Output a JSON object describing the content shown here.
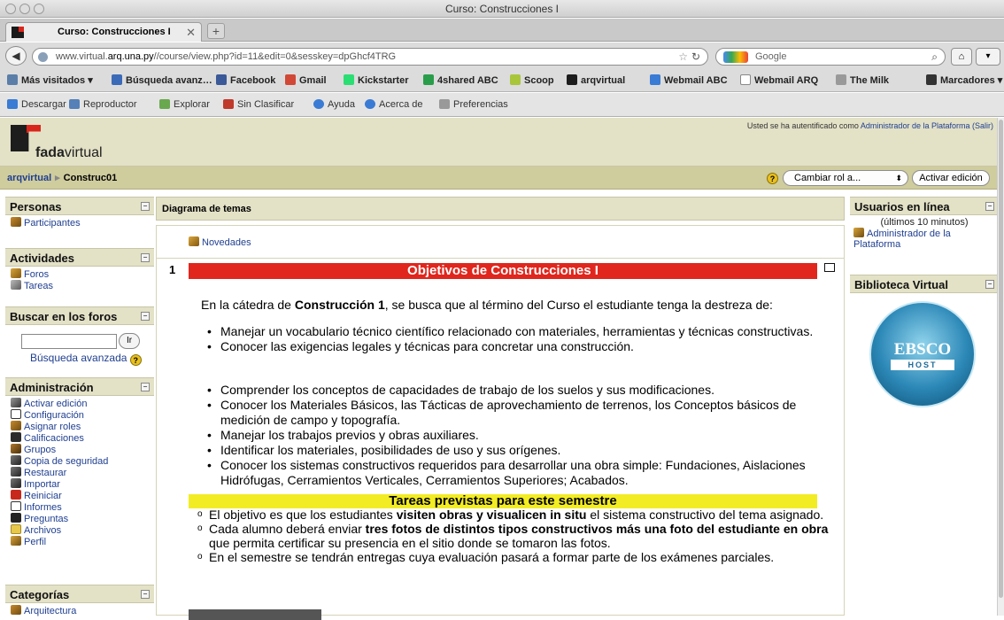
{
  "window": {
    "title": "Curso: Construcciones I"
  },
  "tab": {
    "label": "Curso: Construcciones I",
    "close": "✕",
    "new": "+"
  },
  "nav": {
    "url_prefix": "www.virtual.",
    "url_domain": "arq.una.py",
    "url_path": "//course/view.php?id=11&edit=0&sesskey=dpGhcf4TRG",
    "search_engine": "Google"
  },
  "bookmarks": [
    {
      "label": "Más visitados ▾",
      "icon": "most-visited-icon",
      "color": "#5a7ea8"
    },
    {
      "label": "Búsqueda avanz…",
      "icon": "search-advanced-icon",
      "color": "#3b6ab8"
    },
    {
      "label": "Facebook",
      "icon": "facebook-icon",
      "color": "#3b5998"
    },
    {
      "label": "Gmail",
      "icon": "gmail-icon",
      "color": "#d14836"
    },
    {
      "label": "Kickstarter",
      "icon": "kickstarter-icon",
      "color": "#2bde73"
    },
    {
      "label": "4shared ABC",
      "icon": "4shared-icon",
      "color": "#2a9d4a"
    },
    {
      "label": "Scoop",
      "icon": "scoop-icon",
      "color": "#a9c63a"
    },
    {
      "label": "arqvirtual",
      "icon": "arqvirtual-icon",
      "color": "#1d1d1d"
    },
    {
      "label": "Webmail ABC",
      "icon": "webmail-abc-icon",
      "color": "#3a7bd5"
    },
    {
      "label": "Webmail ARQ",
      "icon": "webmail-arq-icon",
      "color": "#ffffff"
    },
    {
      "label": "The Milk",
      "icon": "milk-icon",
      "color": "#999999"
    }
  ],
  "bookmarks_menu": "Marcadores ▾",
  "addons": [
    {
      "label": "Descargar",
      "icon": "download-icon",
      "color": "#3a7bd5"
    },
    {
      "label": "Reproductor",
      "icon": "player-icon",
      "color": "#5580b8"
    },
    {
      "label": "Explorar",
      "icon": "explore-icon",
      "color": "#6aa84f"
    },
    {
      "label": "Sin Clasificar",
      "icon": "unclassified-icon",
      "color": "#c0392b"
    },
    {
      "label": "Ayuda",
      "icon": "help-icon",
      "color": "#3a7bd5"
    },
    {
      "label": "Acerca de",
      "icon": "about-icon",
      "color": "#3a7bd5"
    },
    {
      "label": "Preferencias",
      "icon": "preferences-icon",
      "color": "#999999"
    }
  ],
  "site": {
    "logo_bold": "fada",
    "logo_rest": "virtual",
    "login_text": "Usted se ha autentificado como ",
    "login_user": "Administrador de la Plataforma",
    "logout": "(Salir)"
  },
  "breadcrumb": {
    "home": "arqvirtual",
    "current": "Construc01"
  },
  "controls": {
    "role_select": "Cambiar rol a...",
    "edit_button": "Activar edición",
    "help": "?"
  },
  "left": {
    "personas": {
      "title": "Personas",
      "items": [
        "Participantes"
      ]
    },
    "actividades": {
      "title": "Actividades",
      "items": [
        "Foros",
        "Tareas"
      ]
    },
    "buscar": {
      "title": "Buscar en los foros",
      "go": "Ir",
      "advanced": "Búsqueda avanzada"
    },
    "admin": {
      "title": "Administración",
      "items": [
        "Activar edición",
        "Configuración",
        "Asignar roles",
        "Calificaciones",
        "Grupos",
        "Copia de seguridad",
        "Restaurar",
        "Importar",
        "Reiniciar",
        "Informes",
        "Preguntas",
        "Archivos",
        "Perfil"
      ]
    },
    "categorias": {
      "title": "Categorías",
      "items": [
        "Arquitectura"
      ]
    }
  },
  "center": {
    "header": "Diagrama de temas",
    "news": "Novedades",
    "topic_number": "1",
    "topic_title": "Objetivos de Construcciones I",
    "intro_a": "En la cátedra de ",
    "intro_b": "Construcción 1",
    "intro_c": ", se busca que al término del Curso el estudiante tenga la destreza de:",
    "list1": [
      "Manejar un vocabulario técnico científico relacionado con materiales, herramientas y técnicas constructivas.",
      "Conocer las exigencias legales y técnicas para concretar una construcción."
    ],
    "list2": [
      "Comprender los conceptos de capacidades de trabajo de los suelos y sus modificaciones.",
      "Conocer los Materiales Básicos, las Tácticas de aprovechamiento de terrenos, los Conceptos básicos de medición de campo y topografía.",
      "Manejar los trabajos previos y obras auxiliares.",
      "Identificar los materiales, posibilidades de uso y sus orígenes.",
      "Conocer los sistemas constructivos requeridos para desarrollar una obra simple: Fundaciones, Aislaciones Hidrófugas, Cerramientos Verticales, Cerramientos Superiores; Acabados."
    ],
    "tasks_title": "Tareas previstas para este semestre",
    "tasks": {
      "t1a": "El objetivo es que los estudiantes ",
      "t1b": "visiten obras y visualicen in situ",
      "t1c": " el sistema constructivo del tema asignado.",
      "t2a": "Cada alumno deberá enviar ",
      "t2b": "tres fotos de distintos tipos constructivos más una foto del estudiante en obra",
      "t2c": " que permita certificar su presencia en el sitio donde se tomaron las fotos.",
      "t3": "En el semestre se tendrán entregas cuya evaluación pasará a formar parte de los exámenes parciales."
    }
  },
  "right": {
    "online": {
      "title": "Usuarios en línea",
      "subtitle": "(últimos 10 minutos)",
      "user": "Administrador de la Plataforma"
    },
    "library": {
      "title": "Biblioteca Virtual",
      "logo_top": "EBSCO",
      "logo_bottom": "HOST"
    }
  }
}
